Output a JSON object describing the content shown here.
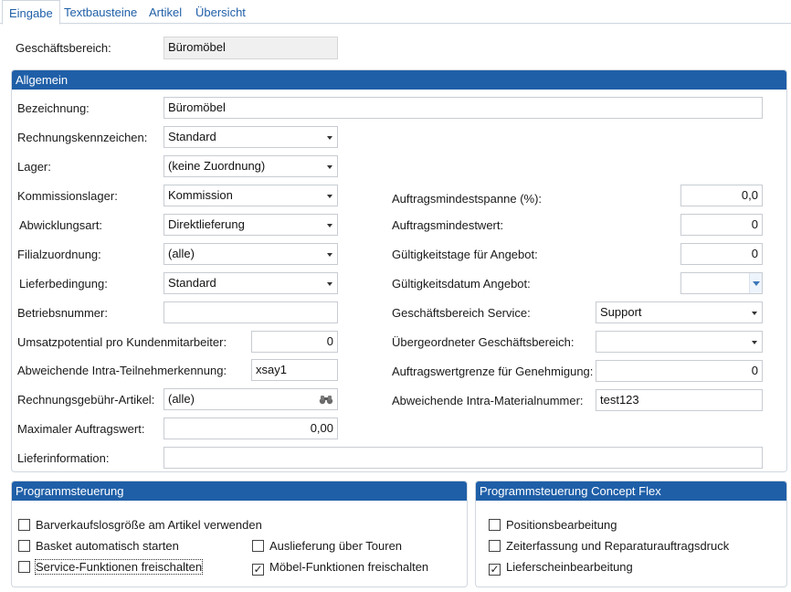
{
  "tabs": [
    {
      "label": "Eingabe",
      "active": true
    },
    {
      "label": "Textbausteine",
      "active": false
    },
    {
      "label": "Artikel",
      "active": false
    },
    {
      "label": "Übersicht",
      "active": false
    }
  ],
  "header": {
    "geschaeftsbereich_label": "Geschäftsbereich:",
    "geschaeftsbereich_value": "Büromöbel"
  },
  "allgemein": {
    "title": "Allgemein",
    "bezeichnung_label": "Bezeichnung:",
    "bezeichnung_value": "Büromöbel",
    "rechnungskennzeichen_label": "Rechnungskennzeichen:",
    "rechnungskennzeichen_value": "Standard",
    "lager_label": "Lager:",
    "lager_value": "(keine Zuordnung)",
    "kommissionslager_label": "Kommissionslager:",
    "kommissionslager_value": "Kommission",
    "abwicklungsart_label": "Abwicklungsart:",
    "abwicklungsart_value": "Direktlieferung",
    "filialzuordnung_label": "Filialzuordnung:",
    "filialzuordnung_value": "(alle)",
    "lieferbedingung_label": "Lieferbedingung:",
    "lieferbedingung_value": "Standard",
    "betriebsnummer_label": "Betriebsnummer:",
    "betriebsnummer_value": "",
    "umsatzpotential_label": "Umsatzpotential pro Kundenmitarbeiter:",
    "umsatzpotential_value": "0",
    "intra_teilnehmer_label": "Abweichende Intra-Teilnehmerkennung:",
    "intra_teilnehmer_value": "xsay1",
    "rechnungsgebuehr_label": "Rechnungsgebühr-Artikel:",
    "rechnungsgebuehr_value": "(alle)",
    "max_auftragswert_label": "Maximaler Auftragswert:",
    "max_auftragswert_value": "0,00",
    "lieferinformation_label": "Lieferinformation:",
    "lieferinformation_value": "",
    "auftragsmindestspanne_label": "Auftragsmindestspanne (%):",
    "auftragsmindestspanne_value": "0,0",
    "auftragsmindestwert_label": "Auftragsmindestwert:",
    "auftragsmindestwert_value": "0",
    "gueltigkeitstage_label": "Gültigkeitstage für Angebot:",
    "gueltigkeitstage_value": "0",
    "gueltigkeitsdatum_label": "Gültigkeitsdatum Angebot:",
    "gueltigkeitsdatum_value": "",
    "gb_service_label": "Geschäftsbereich Service:",
    "gb_service_value": "Support",
    "uebergeordnet_label": "Übergeordneter Geschäftsbereich:",
    "uebergeordnet_value": "",
    "auftragswertgrenze_label": "Auftragswertgrenze für Genehmigung:",
    "auftragswertgrenze_value": "0",
    "intra_material_label": "Abweichende Intra-Materialnummer:",
    "intra_material_value": "test123"
  },
  "programmsteuerung": {
    "title": "Programmsteuerung",
    "items": [
      {
        "label": "Barverkaufslosgröße am Artikel verwenden",
        "checked": false
      },
      {
        "label": "Basket automatisch starten",
        "checked": false
      },
      {
        "label": "Service-Funktionen freischalten",
        "checked": false
      },
      {
        "label": "Auslieferung über Touren",
        "checked": false
      },
      {
        "label": "Möbel-Funktionen freischalten",
        "checked": true
      }
    ]
  },
  "concept_flex": {
    "title": "Programmsteuerung Concept Flex",
    "items": [
      {
        "label": "Positionsbearbeitung",
        "checked": false
      },
      {
        "label": "Zeiterfassung und Reparaturauftragsdruck",
        "checked": false
      },
      {
        "label": "Lieferscheinbearbeitung",
        "checked": true
      }
    ]
  },
  "colors": {
    "accent": "#1f5fa8",
    "tab_text": "#1f5fa8",
    "readonly_bg": "#f0f0f0"
  },
  "icons": {
    "dropdown": "chevron-down-icon",
    "lookup": "binoculars-icon",
    "checkmark": "check-icon"
  }
}
